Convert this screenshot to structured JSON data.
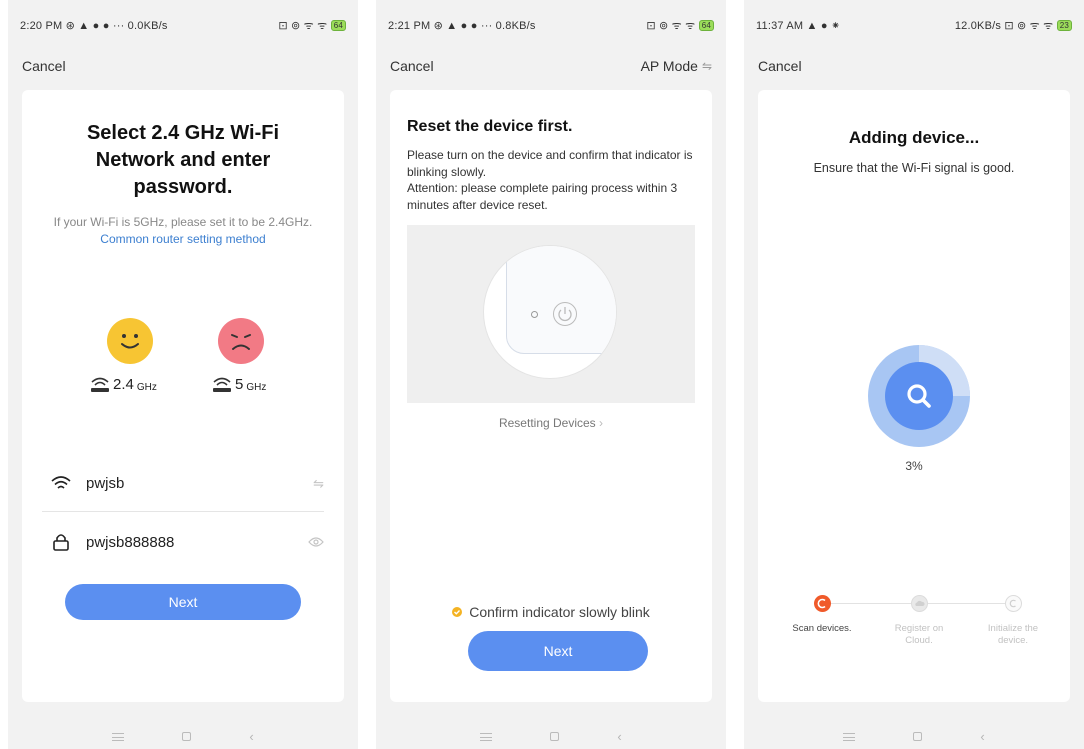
{
  "screen1": {
    "status": {
      "left": "2:20 PM ⊛ ▲ ● ● ··· 0.0KB/s",
      "right": "⊡ ⊚ ᯤ ᯤ",
      "battery": "64"
    },
    "cancel": "Cancel",
    "title": "Select 2.4 GHz Wi-Fi Network and enter password.",
    "hint_text": "If your Wi-Fi is 5GHz, please set it to be 2.4GHz.",
    "hint_link": "Common router setting method",
    "band_24": {
      "value": "2.4",
      "unit": "GHz"
    },
    "band_5": {
      "value": "5",
      "unit": "GHz"
    },
    "ssid": "pwjsb",
    "password": "pwjsb888888",
    "next": "Next"
  },
  "screen2": {
    "status": {
      "left": "2:21 PM ⊛ ▲ ● ● ··· 0.8KB/s",
      "right": "⊡ ⊚ ᯤ ᯤ",
      "battery": "64"
    },
    "cancel": "Cancel",
    "mode": "AP Mode",
    "title": "Reset the device first.",
    "desc1": "Please turn on the device and confirm that indicator is blinking slowly.",
    "desc2": "Attention: please complete pairing process within 3 minutes after device reset.",
    "reset_link": "Resetting Devices",
    "confirm": "Confirm indicator slowly blink",
    "next": "Next"
  },
  "screen3": {
    "status": {
      "left": "11:37 AM ▲ ● ⁕",
      "right": "12.0KB/s ⊡ ⊚ ᯤ ᯤ",
      "battery": "23"
    },
    "cancel": "Cancel",
    "title": "Adding device...",
    "subtitle": "Ensure that the Wi-Fi signal is good.",
    "progress": "3%",
    "progress_value": 0.03,
    "steps": [
      {
        "label": "Scan devices.",
        "state": "active"
      },
      {
        "label": "Register on Cloud.",
        "state": "pending"
      },
      {
        "label": "Initialize the device.",
        "state": "pending"
      }
    ]
  },
  "icons": [
    "wifi-icon",
    "lock-icon",
    "eye-icon",
    "swap-icon",
    "router-icon",
    "search-icon",
    "power-icon",
    "check-icon"
  ],
  "colors": {
    "accent": "#5b8ff0",
    "link": "#3c7fd0",
    "happy": "#f7c533",
    "sad": "#f27a85",
    "step_active": "#f05a2a",
    "warning": "#f4b323"
  }
}
